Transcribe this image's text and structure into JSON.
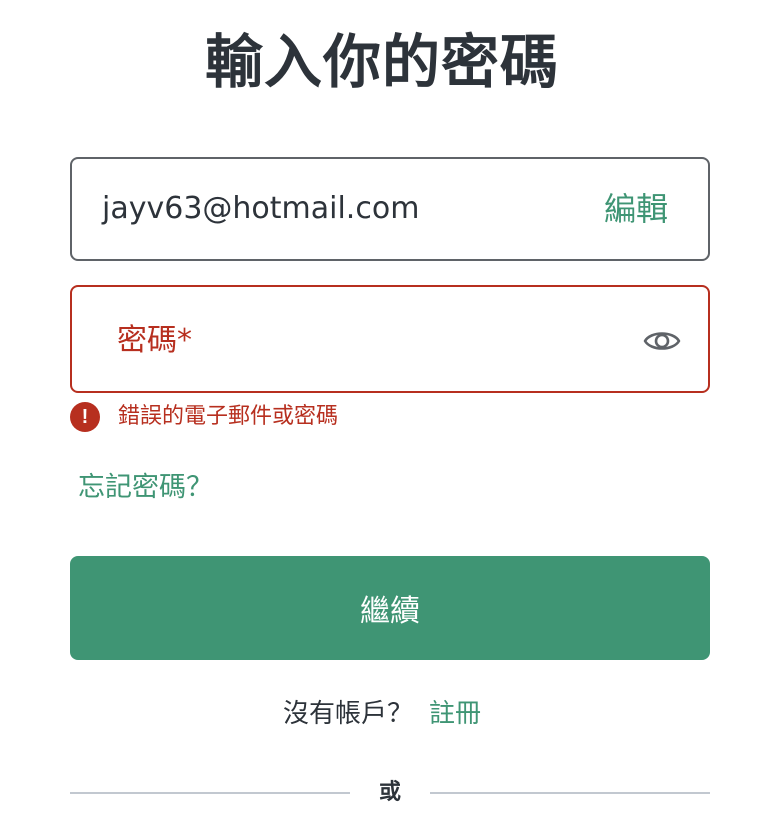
{
  "page": {
    "title": "輸入你的密碼"
  },
  "email_field": {
    "value": "jayv63@hotmail.com",
    "edit_label": "編輯"
  },
  "password_field": {
    "label": "密碼*",
    "value": "",
    "toggle_icon": "eye-icon"
  },
  "error": {
    "icon": "error-icon",
    "message": "錯誤的電子郵件或密碼"
  },
  "forgot_password": {
    "label": "忘記密碼？"
  },
  "continue_button": {
    "label": "繼續"
  },
  "signup": {
    "prompt": "沒有帳戶？",
    "link_label": "註冊"
  },
  "divider": {
    "label": "或"
  },
  "colors": {
    "primary": "#3f9574",
    "error": "#b72f1f",
    "text": "#2d333a",
    "border": "#5f6368",
    "divider": "#c2c8d0"
  }
}
